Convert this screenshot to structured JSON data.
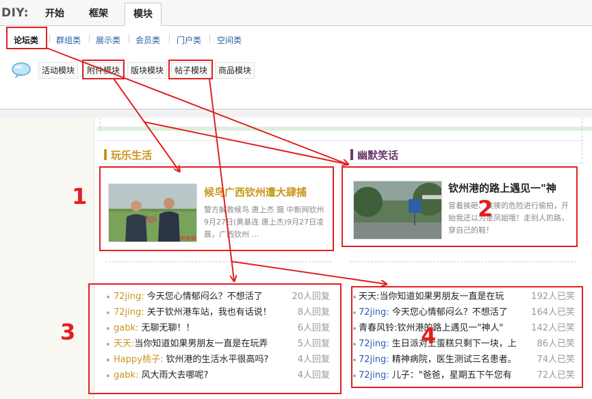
{
  "topbar": {
    "diy_label": "DIY:",
    "tabs": [
      {
        "label": "开始"
      },
      {
        "label": "框架"
      },
      {
        "label": "模块"
      }
    ]
  },
  "categories": [
    "论坛类",
    "群组类",
    "展示类",
    "会员类",
    "门户类",
    "空间类"
  ],
  "modules": [
    "活动模块",
    "附件模块",
    "版块模块",
    "帖子模块",
    "商品模块"
  ],
  "left_section": {
    "heading": "玩乐生活",
    "accent_color": "#c9951a",
    "feature": {
      "title": "候鸟广西钦州遭大肆捕",
      "summary": "警方解救候鸟 唐上杰 摄 中新网钦州9月27日(黄基连 唐上杰)9月27日凌晨，广西钦州 …",
      "watermark": "中新网"
    },
    "threads": [
      {
        "user": "72jing:",
        "title": "今天您心情郁闷么？不想活了",
        "count": "20人回复"
      },
      {
        "user": "72jing:",
        "title": "关于钦州港车站，我也有话说！",
        "count": "8人回复"
      },
      {
        "user": "gabk:",
        "title": "无聊无聊！！",
        "count": "6人回复"
      },
      {
        "user": "天天:",
        "title": "当你知道如果男朋友一直是在玩弄",
        "count": "5人回复"
      },
      {
        "user": "Happy桃子:",
        "title": "钦州港的生活水平很高吗?",
        "count": "4人回复"
      },
      {
        "user": "gabk:",
        "title": "风大雨大去哪呢?",
        "count": "4人回复"
      }
    ]
  },
  "right_section": {
    "heading": "幽默笑话",
    "accent_color": "#6b3a6b",
    "feature": {
      "title": "钦州港的路上遇见一\"神",
      "summary": "冒着挨砸、挨揍的危险进行偷拍，开始我还以为是凤姐哦！走别人的路，穿自己的鞋！"
    },
    "threads": [
      {
        "user": "天天:",
        "title": "当你知道如果男朋友一直是在玩",
        "count": "192人已笑"
      },
      {
        "user": "72jing:",
        "title": "今天您心情郁闷么？不想活了",
        "count": "164人已笑"
      },
      {
        "user": "青春风铃:",
        "title": "钦州港的路上遇见一\"神人\"",
        "count": "142人已笑"
      },
      {
        "user": "72jing:",
        "title": "生日派对上蛋糕只剩下一块，上",
        "count": "86人已笑"
      },
      {
        "user": "72jing:",
        "title": "精神病院，医生测试三名患者。",
        "count": "74人已笑"
      },
      {
        "user": "72jing:",
        "title": "儿子：\"爸爸，星期五下午您有",
        "count": "72人已笑"
      }
    ]
  },
  "annotations": {
    "numbers": [
      "1",
      "2",
      "3",
      "4"
    ],
    "color": "#e02020"
  }
}
